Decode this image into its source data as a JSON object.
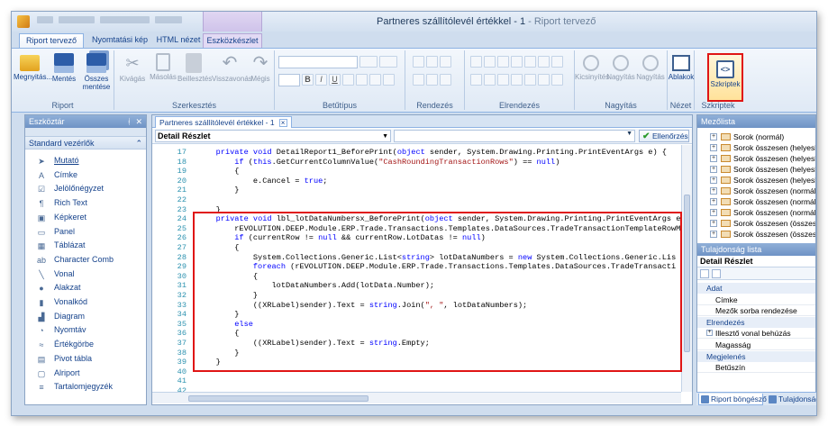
{
  "window": {
    "title": "Partneres szállítólevél értékkel - 1",
    "app_suffix": " - Riport tervező"
  },
  "ribbon_tabs": [
    "Riport tervező",
    "Nyomtatási kép",
    "HTML nézet",
    "Eszközkészlet"
  ],
  "ribbon": {
    "groups": {
      "riport": "Riport",
      "szerkesztes": "Szerkesztés",
      "betutipus": "Betűtípus",
      "rendezes": "Rendezés",
      "elrendezes": "Elrendezés",
      "nagyitas": "Nagyítás",
      "nezet": "Nézet",
      "szkriptek": "Szkriptek"
    },
    "buttons": {
      "open": "Megnyitás...",
      "save": "Mentés",
      "save_all": "Összes mentése",
      "cut": "Kivágás",
      "copy": "Másolás",
      "paste": "Beillesztés",
      "undo": "Visszavonás",
      "redo": "Mégis",
      "zoom_out": "Kicsinyítés",
      "zoom": "Nagyítás",
      "zoom_in": "Nagyítás",
      "windows": "Ablakok",
      "scripts": "Szkriptek"
    }
  },
  "toolbox": {
    "title": "Eszköztár",
    "pin_icon": "pin-icon",
    "group": "Standard vezérlők",
    "items": [
      {
        "label": "Mutató",
        "icon": "pointer-icon"
      },
      {
        "label": "Címke",
        "icon": "label-icon"
      },
      {
        "label": "Jelölőnégyzet",
        "icon": "checkbox-icon"
      },
      {
        "label": "Rich Text",
        "icon": "richtext-icon"
      },
      {
        "label": "Képkeret",
        "icon": "picture-icon"
      },
      {
        "label": "Panel",
        "icon": "panel-icon"
      },
      {
        "label": "Táblázat",
        "icon": "table-icon"
      },
      {
        "label": "Character Comb",
        "icon": "charcomb-icon"
      },
      {
        "label": "Vonal",
        "icon": "line-icon"
      },
      {
        "label": "Alakzat",
        "icon": "shape-icon"
      },
      {
        "label": "Vonalkód",
        "icon": "barcode-icon"
      },
      {
        "label": "Diagram",
        "icon": "chart-icon"
      },
      {
        "label": "Nyomtáv",
        "icon": "zipcode-icon"
      },
      {
        "label": "Értékgörbe",
        "icon": "sparkline-icon"
      },
      {
        "label": "Pivot tábla",
        "icon": "pivot-icon"
      },
      {
        "label": "Alriport",
        "icon": "subreport-icon"
      },
      {
        "label": "Tartalomjegyzék",
        "icon": "toc-icon"
      }
    ]
  },
  "document": {
    "tab": "Partneres szállítólevél értékkel - 1",
    "object_select": "Detail  Részlet",
    "event_select": "",
    "check_button": "Ellenőrzés",
    "line_numbers": [
      "17",
      "18",
      "19",
      "20",
      "21",
      "22",
      "23",
      "24",
      "25",
      "26",
      "27",
      "28",
      "29",
      "30",
      "31",
      "32",
      "33",
      "34",
      "35",
      "36",
      "37",
      "38",
      "39",
      "40",
      "41",
      "42"
    ],
    "code_lines": [
      "    private void DetailReport1_BeforePrint(object sender, System.Drawing.Printing.PrintEventArgs e) {",
      "        if (this.GetCurrentColumnValue(\"CashRoundingTransactionRows\") == null)",
      "        {",
      "            e.Cancel = true;",
      "        }",
      "",
      "    }",
      "    private void lbl_lotDataNumbersx_BeforePrint(object sender, System.Drawing.Printing.PrintEventArgs e)",
      "        rEVOLUTION.DEEP.Module.ERP.Trade.Transactions.Templates.DataSources.TradeTransactionTemplateRowM",
      "        if (currentRow != null && currentRow.LotDatas != null)",
      "        {",
      "            System.Collections.Generic.List<string> lotDataNumbers = new System.Collections.Generic.Lis",
      "            foreach (rEVOLUTION.DEEP.Module.ERP.Trade.Transactions.Templates.DataSources.TradeTransacti",
      "            {",
      "                lotDataNumbers.Add(lotData.Number);",
      "            }",
      "            ((XRLabel)sender).Text = string.Join(\", \", lotDataNumbers);",
      "        }",
      "        else",
      "        {",
      "            ((XRLabel)sender).Text = string.Empty;",
      "        }",
      "    }",
      "",
      "",
      ""
    ]
  },
  "field_list": {
    "title": "Mezőlista",
    "items": [
      "Sorok (normál)",
      "Sorok összesen (helyesbítet",
      "Sorok összesen (helyesbítet",
      "Sorok összesen (helyesbítet",
      "Sorok összesen (helyesbítet",
      "Sorok összesen (normál - elő",
      "Sorok összesen (normál - ker",
      "Sorok összesen (normál - nor",
      "Sorok összesen (összes - elő",
      "Sorok összesen (összes - ker"
    ]
  },
  "property_list": {
    "title": "Tulajdonság lista",
    "selection": "Detail  Részlet",
    "rows": [
      {
        "kind": "cat",
        "label": "Adat"
      },
      {
        "kind": "row",
        "label": "Címke"
      },
      {
        "kind": "row",
        "label": "Mezők sorba rendezése"
      },
      {
        "kind": "cat",
        "label": "Elrendezés"
      },
      {
        "kind": "row",
        "label": "Illesztő vonal behúzás",
        "expandable": true
      },
      {
        "kind": "row",
        "label": "Magasság"
      },
      {
        "kind": "cat",
        "label": "Megjelenés"
      },
      {
        "kind": "row",
        "label": "Betűszín"
      }
    ]
  },
  "bottom_tabs": [
    "Riport böngésző",
    "Tulajdonság"
  ],
  "colors": {
    "highlight": "#e01515",
    "keyword": "#0000ff",
    "string": "#a31515",
    "line_number": "#2b91af"
  }
}
